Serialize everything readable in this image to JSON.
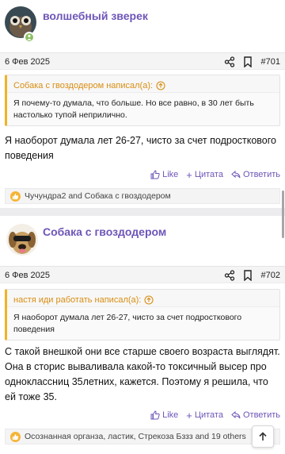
{
  "posts": [
    {
      "username": "волшебный зверек",
      "date": "6 Фев 2025",
      "number": "#701",
      "quote_author": "Собака с гвоздодером написал(а):",
      "quote_text": "Я почему-то думала, что больше. Но все равно, в 30 лет быть настолько тупой неприлично.",
      "text": "Я наоборот думала лет 26-27, чисто за счет подросткового поведения",
      "actions": {
        "like": "Like",
        "quote": "Цитата",
        "reply": "Ответить"
      },
      "reactions": "Чучундра2 and Собака с гвоздодером"
    },
    {
      "username": "Собака с гвоздодером",
      "date": "6 Фев 2025",
      "number": "#702",
      "quote_author": "настя иди работать написал(а):",
      "quote_text": "Я наоборот думала лет 26-27, чисто за счет подросткового поведения",
      "text": "С такой внешкой они все старше своего возраста выглядят. Она в сторис вываливала какой-то токсичный высер про одноклассниц 35летних, кажется. Поэтому я решила, что ей тоже 35.",
      "actions": {
        "like": "Like",
        "quote": "Цитата",
        "reply": "Ответить"
      },
      "reactions": "Осознанная органза, ластик, Стрекоза Бззз and 19 others"
    }
  ],
  "colors": {
    "accent": "#6e55b8",
    "quote_accent": "#f0b322",
    "like": "#f6b434"
  }
}
